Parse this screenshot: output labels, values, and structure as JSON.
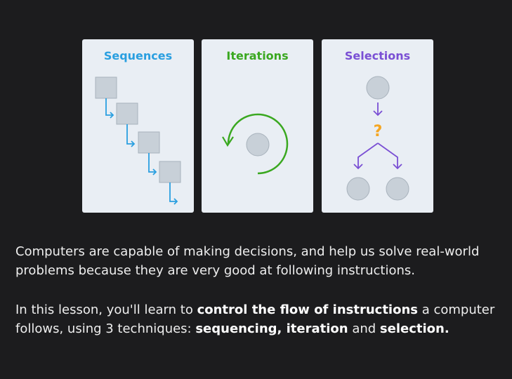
{
  "cards": [
    {
      "title": "Sequences",
      "color": "#2a9fe0",
      "illustration": "sequence-steps"
    },
    {
      "title": "Iterations",
      "color": "#3aa820",
      "illustration": "loop-circle"
    },
    {
      "title": "Selections",
      "color": "#7a4fd4",
      "illustration": "decision-branch",
      "decision_symbol": "?",
      "decision_color": "#f5a623"
    }
  ],
  "body": {
    "paragraph1": "Computers are capable of making decisions, and help us solve real-world problems because they are very good at following instructions.",
    "paragraph2_prefix": "In this lesson, you'll learn to ",
    "paragraph2_bold1": "control the flow of instructions",
    "paragraph2_mid": " a computer follows, using 3 techniques: ",
    "paragraph2_bold2": "sequencing, iteration",
    "paragraph2_and": " and ",
    "paragraph2_bold3": "selection",
    "paragraph2_end": "."
  }
}
